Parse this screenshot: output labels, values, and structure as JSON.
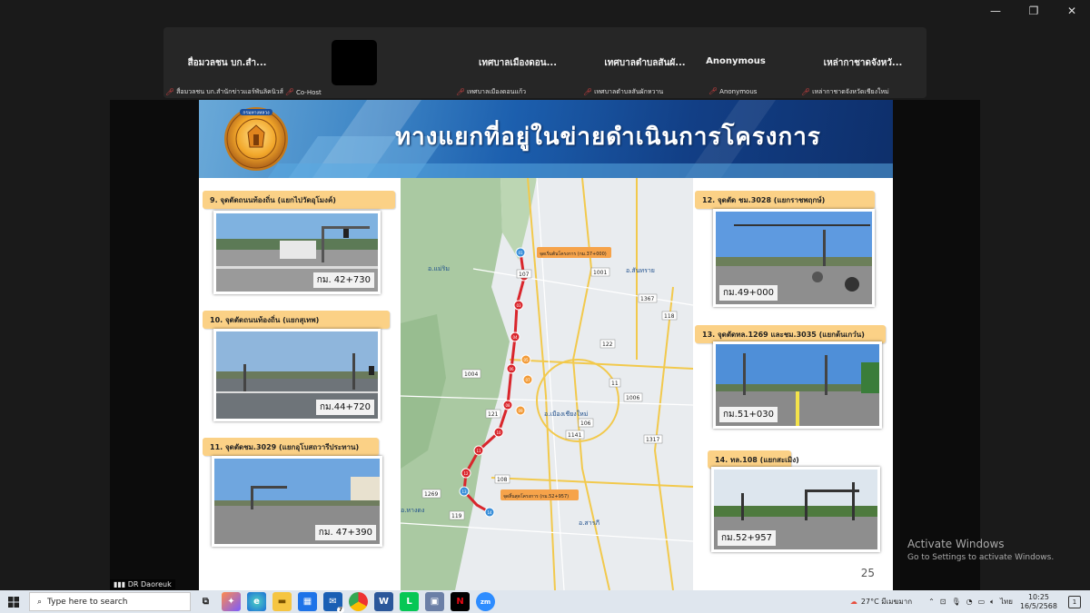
{
  "window": {
    "minimize": "—",
    "restore": "❐",
    "close": "✕"
  },
  "participants": [
    {
      "name": "สื่อมวลชน บก.สำ...",
      "label": "สื่อมวลชน บก.สำนักข่าวแอร์พันลิคนิวส์",
      "extra": "Co-Host"
    },
    {
      "name": "",
      "label": ""
    },
    {
      "name": "เทศบาลเมืองดอน...",
      "label": "เทศบาลเมืองดอนแก้ว"
    },
    {
      "name": "เทศบาลตำบลสันผั...",
      "label": "เทศบาลตำบลสันผักหวาน"
    },
    {
      "name": "Anonymous",
      "label": "Anonymous"
    },
    {
      "name": "เหล่ากาชาดจังหวั...",
      "label": "เหล่ากาชาดจังหวัดเชียงใหม่"
    }
  ],
  "slide": {
    "title": "ทางแยกที่อยู่ในข่ายดำเนินการโครงการ",
    "page": "25",
    "logo_text": "กรมทางหลวง",
    "cards": [
      {
        "label": "9. จุดตัดถนนท้องถิ่น (แยกไปวัดอุโมงค์)",
        "km": "กม. 42+730"
      },
      {
        "label": "10. จุดตัดถนนท้องถิ่น (แยกสุเทพ)",
        "km": "กม.44+720"
      },
      {
        "label": "11. จุดตัดชม.3029 (แยกอุโบสถวารีประทาน)",
        "km": "กม. 47+390"
      },
      {
        "label": "12. จุดตัด ชม.3028 (แยกราชพฤกษ์)",
        "km": "กม.49+000"
      },
      {
        "label": "13. จุดตัดทล.1269 และชม.3035 (แยกต้นเกว๋น)",
        "km": "กม.51+030"
      },
      {
        "label": "14. ทล.108 (แยกสะเมิง)",
        "km": "กม.52+957"
      }
    ],
    "map": {
      "start_label": "จุดเริ่มต้นโครงการ (กม.37+000)",
      "end_label": "จุดสิ้นสุดโครงการ (กม.52+957)",
      "places": [
        "อ.แม่ริม",
        "อ.สันทราย",
        "อ.เมืองเชียงใหม่",
        "อ.หางดง",
        "อ.สารภี"
      ],
      "roads": [
        "107",
        "1001",
        "1367",
        "118",
        "122",
        "1004",
        "121",
        "11",
        "1006",
        "106",
        "1141",
        "1317",
        "108",
        "1269",
        "119"
      ],
      "points": [
        "01",
        "02",
        "03",
        "04",
        "05",
        "06",
        "07",
        "08",
        "09",
        "10",
        "11",
        "12",
        "13",
        "14"
      ]
    }
  },
  "overlay": {
    "activate_title": "Activate Windows",
    "activate_sub": "Go to Settings to activate Windows.",
    "zoom_name": "DR Daoreuk"
  },
  "taskbar": {
    "search_placeholder": "Type here to search",
    "weather": "27°C มีเมฆมาก",
    "lang": "ไทย",
    "time": "10:25",
    "date": "16/5/2568",
    "notif": "1",
    "outlook_badge": "7",
    "zoom_label": "zm"
  },
  "colors": {
    "accent": "#0e2f6b",
    "label_bg": "#fbd186",
    "route": "#d9262c"
  }
}
